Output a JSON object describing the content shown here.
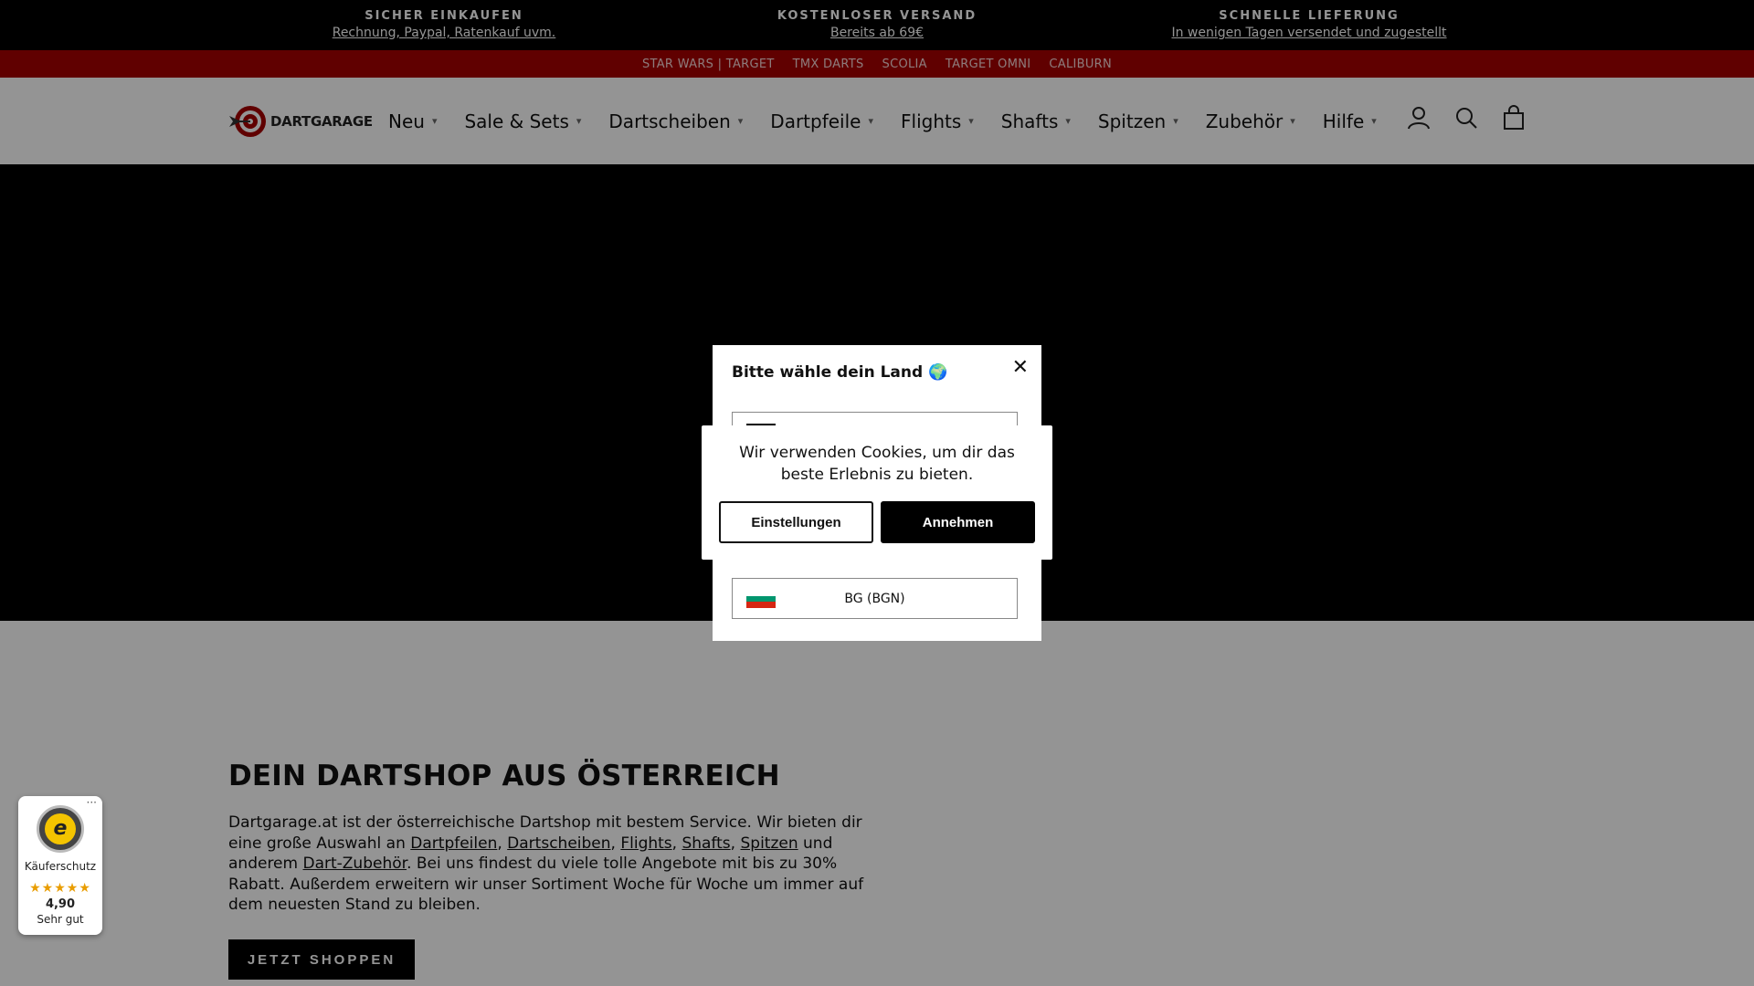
{
  "promo": [
    {
      "title": "SICHER EINKAUFEN",
      "link": "Rechnung, Paypal, Ratenkauf uvm."
    },
    {
      "title": "KOSTENLOSER VERSAND",
      "link": "Bereits ab 69€"
    },
    {
      "title": "SCHNELLE LIEFERUNG",
      "link": "In wenigen Tagen versendet und zugestellt"
    }
  ],
  "brands": [
    "STAR WARS | TARGET",
    "TMX DARTS",
    "SCOLIA",
    "TARGET OMNI",
    "CALIBURN"
  ],
  "header": {
    "logo_text": "DARTGARAGE",
    "nav": [
      "Neu",
      "Sale & Sets",
      "Dartscheiben",
      "Dartpfeile",
      "Flights",
      "Shafts",
      "Spitzen",
      "Zubehör",
      "Hilfe"
    ],
    "icons": [
      "account-icon",
      "search-icon",
      "cart-icon"
    ]
  },
  "intro": {
    "title": "DEIN DARTSHOP AUS ÖSTERREICH",
    "text_1": "Dartgarage.at ist der österreichische Dartshop mit bestem Service. Wir bieten dir eine große Auswahl an ",
    "link_1": "Dartpfeilen",
    "sep_1": ", ",
    "link_2": "Dartscheiben",
    "sep_2": ", ",
    "link_3": "Flights",
    "sep_3": ", ",
    "link_4": "Shafts",
    "sep_4": ", ",
    "link_5": "Spitzen",
    "text_2": " und anderem ",
    "link_6": "Dart-Zubehör",
    "text_3": ". Bei uns findest du viele tolle Angebote mit bis zu 30% Rabatt. Außerdem erweitern wir unser Sortiment Woche für Woche um immer auf dem neuesten Stand zu bleiben.",
    "button": "JETZT SHOPPEN"
  },
  "trust_badge": {
    "label": "Käuferschutz",
    "stars": "★★★★★",
    "score": "4,90",
    "grade": "Sehr gut",
    "menu": "···",
    "seal_letter": "e"
  },
  "country_modal": {
    "title": "Bitte wähle dein Land 🌍",
    "close": "✕",
    "option_visible": "BG (BGN)"
  },
  "cookie": {
    "text": "Wir verwenden Cookies, um dir das beste Erlebnis zu bieten.",
    "settings": "Einstellungen",
    "accept": "Annehmen"
  },
  "colors": {
    "brand_bar": "#a50000",
    "hero": "#000000",
    "stars": "#e99d00"
  }
}
